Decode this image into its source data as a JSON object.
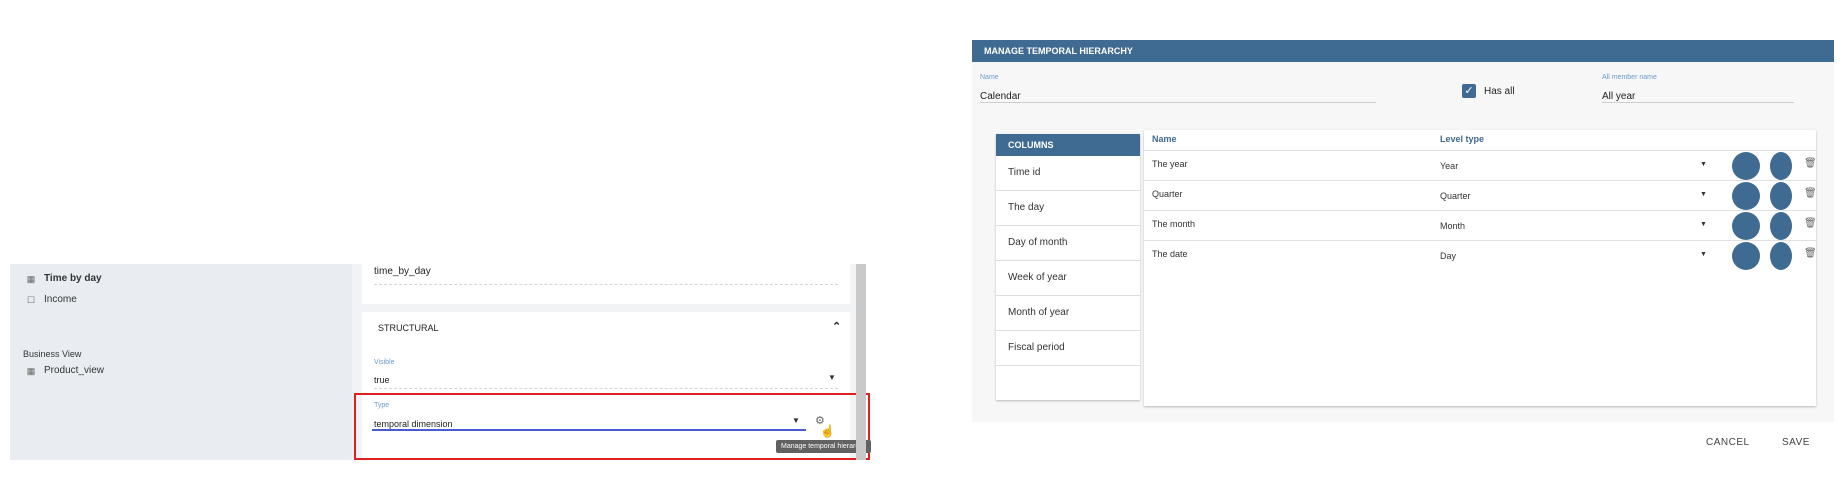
{
  "left_panel": {
    "tree": [
      {
        "label": "Time by day",
        "icon": "table-icon",
        "bold": true
      },
      {
        "label": "Income",
        "icon": "square-icon",
        "bold": false
      }
    ],
    "business_view": {
      "heading": "Business View",
      "item": {
        "label": "Product_view",
        "icon": "table-icon"
      }
    }
  },
  "detail": {
    "table_value": "time_by_day",
    "section_title": "STRUCTURAL",
    "visible": {
      "label": "Visible",
      "value": "true"
    },
    "type": {
      "label": "Type",
      "value": "temporal dimension"
    },
    "tooltip": "Manage temporal hierarchy"
  },
  "dialog": {
    "title": "MANAGE TEMPORAL HIERARCHY",
    "name_field": {
      "label": "Name",
      "value": "Calendar"
    },
    "has_all": {
      "label": "Has all",
      "checked": true
    },
    "all_member": {
      "label": "All member name",
      "value": "All year"
    },
    "columns_heading": "COLUMNS",
    "columns": [
      "Time id",
      "The day",
      "Day of month",
      "Week of year",
      "Month of year",
      "Fiscal period"
    ],
    "levels_headers": {
      "name": "Name",
      "level_type": "Level type"
    },
    "levels": [
      {
        "name": "The year",
        "type": "Year"
      },
      {
        "name": "Quarter",
        "type": "Quarter"
      },
      {
        "name": "The month",
        "type": "Month"
      },
      {
        "name": "The date",
        "type": "Day"
      }
    ],
    "buttons": {
      "cancel": "CANCEL",
      "save": "SAVE"
    },
    "accent_color": "#3f6a91"
  }
}
